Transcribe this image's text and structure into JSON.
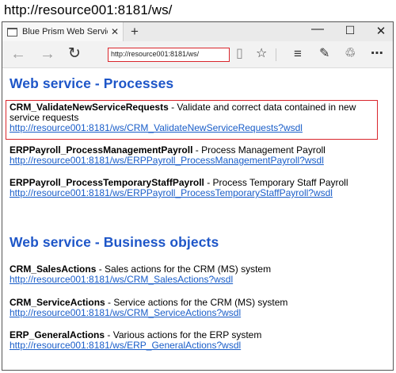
{
  "caption": "http://resource001:8181/ws/",
  "browser": {
    "tab_title": "Blue Prism Web Services",
    "tab_close": "✕",
    "new_tab": "+",
    "minimize": "—",
    "maximize": "☐",
    "close": "✕",
    "address": "http://resource001:8181/ws/"
  },
  "sections": {
    "processes_heading": "Web service - Processes",
    "business_heading": "Web service - Business objects"
  },
  "processes": [
    {
      "name": "CRM_ValidateNewServiceRequests",
      "desc": " - Validate and correct data contained in new service requests",
      "url": "http://resource001:8181/ws/CRM_ValidateNewServiceRequests?wsdl"
    },
    {
      "name": "ERPPayroll_ProcessManagementPayroll",
      "desc": " - Process Management Payroll",
      "url": "http://resource001:8181/ws/ERPPayroll_ProcessManagementPayroll?wsdl"
    },
    {
      "name": "ERPPayroll_ProcessTemporaryStaffPayroll",
      "desc": " - Process Temporary Staff Payroll",
      "url": "http://resource001:8181/ws/ERPPayroll_ProcessTemporaryStaffPayroll?wsdl"
    }
  ],
  "business_objects": [
    {
      "name": "CRM_SalesActions",
      "desc": " - Sales actions for the CRM (MS) system",
      "url": "http://resource001:8181/ws/CRM_SalesActions?wsdl"
    },
    {
      "name": "CRM_ServiceActions",
      "desc": " - Service actions for the CRM (MS) system",
      "url": "http://resource001:8181/ws/CRM_ServiceActions?wsdl"
    },
    {
      "name": "ERP_GeneralActions",
      "desc": " - Various actions for the ERP system",
      "url": "http://resource001:8181/ws/ERP_GeneralActions?wsdl"
    }
  ]
}
